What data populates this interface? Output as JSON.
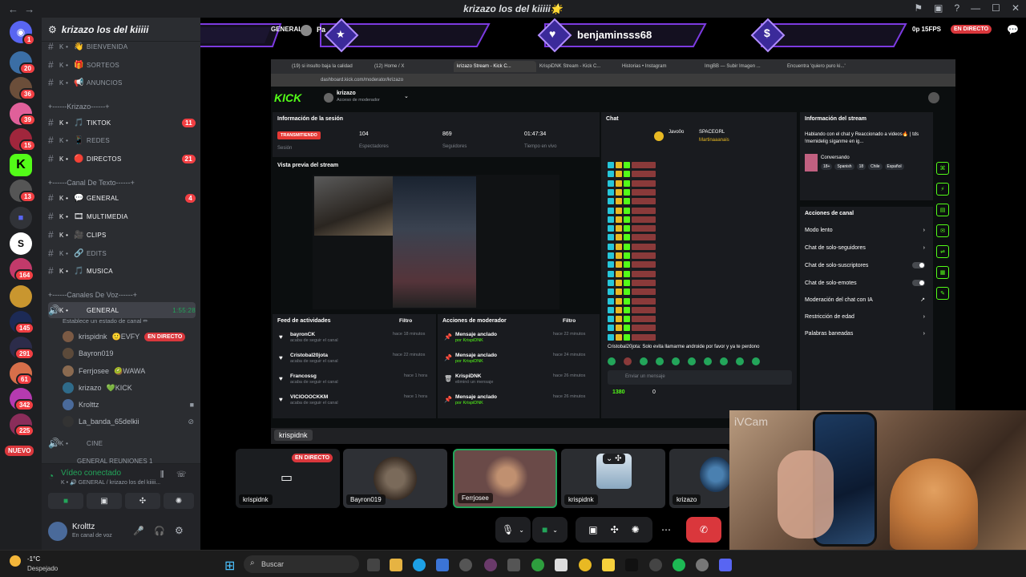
{
  "window": {
    "title": "krizazo los del kiiiii🌟",
    "back": "←",
    "forward": "→"
  },
  "rail": {
    "new_label": "NUEVO",
    "badges": [
      "1",
      "20",
      "36",
      "39",
      "15",
      "13",
      "164",
      "145",
      "291",
      "61",
      "342",
      "225"
    ]
  },
  "server": {
    "name": "krizazo los del kiiiii"
  },
  "channels": {
    "top": [
      {
        "k": "K •",
        "icon": "👋",
        "name": "BIENVENIDA",
        "count": ""
      },
      {
        "k": "K •",
        "icon": "🎁",
        "name": "SORTEOS",
        "count": ""
      },
      {
        "k": "K •",
        "icon": "📢",
        "name": "ANUNCIOS",
        "count": ""
      }
    ],
    "cat_krizazo": "+------Krizazo------+",
    "krizazo": [
      {
        "k": "K •",
        "icon": "🎵",
        "name": "TIKTOK",
        "count": "11"
      },
      {
        "k": "K •",
        "icon": "📱",
        "name": "REDES",
        "count": ""
      },
      {
        "k": "K •",
        "icon": "🔴",
        "name": "DIRECTOS",
        "count": "21"
      }
    ],
    "cat_texto": "+------Canal De Texto------+",
    "texto": [
      {
        "k": "K •",
        "icon": "💬",
        "name": "GENERAL",
        "count": "4"
      },
      {
        "k": "K •",
        "icon": "🎞",
        "name": "MULTIMEDIA",
        "count": ""
      },
      {
        "k": "K •",
        "icon": "🎥",
        "name": "CLIPS",
        "count": ""
      },
      {
        "k": "K •",
        "icon": "🔗",
        "name": "EDITS",
        "count": ""
      },
      {
        "k": "K •",
        "icon": "🎵",
        "name": "MUSICA",
        "count": ""
      }
    ],
    "cat_voz": "+------Canales De Voz------+",
    "voice_general": {
      "k": "K •",
      "icon": "🔊",
      "name": "GENERAL",
      "timer": "1:55:28",
      "status": "Establece un estado de canal ✏"
    },
    "voice_users": [
      {
        "name": "krispidnk",
        "tag": "🙂EVFY",
        "live": "EN DIRECTO",
        "color": "#7b5a44"
      },
      {
        "name": "Bayron019",
        "tag": "",
        "live": "",
        "color": "#5c4a3a"
      },
      {
        "name": "Ferrjosee",
        "tag": "🥝WAWA",
        "live": "",
        "color": "#8a6a50"
      },
      {
        "name": "krizazo",
        "tag": "💚KICK",
        "live": "",
        "color": "#2f6b8a"
      },
      {
        "name": "Krolttz",
        "tag": "",
        "live": "",
        "color": "#4a6a9a"
      },
      {
        "name": "La_banda_65delkii",
        "tag": "",
        "live": "",
        "color": "#333"
      }
    ],
    "cine": {
      "k": "K •",
      "icon": "🔊",
      "name": "CINE"
    },
    "reuniones": "GENERAL REUNIONES 1"
  },
  "voice_panel": {
    "status": "Vídeo conectado",
    "location": "K • 🔊 GENERAL / krizazo los del kiiiii..."
  },
  "user_panel": {
    "name": "Krolttz",
    "status": "En canal de voz"
  },
  "banner": {
    "ch_label": "GENERAL",
    "name1": "Pa",
    "center_name": "benjaminsss68",
    "right_text": "0p 15FPS",
    "live": "EN DIRECTO"
  },
  "browser": {
    "tabs": [
      "(19) si insulto baja la calidad",
      "(12) Home / X",
      "krizazo Stream - Kick C...",
      "KrispiDNK Stream - Kick C...",
      "Historias • Instagram",
      "ImgBB — Subir Imagen ...",
      "Encuentra 'quiero puro ki...'"
    ],
    "url": "dashboard.kick.com/moderator/krizazo"
  },
  "kick": {
    "logo": "KICK",
    "channel": "krizazo",
    "role": "Acceso de moderador",
    "session_title": "Información de la sesión",
    "live_badge": "TRANSMITIENDO",
    "session_label": "Sesión",
    "viewers": "104",
    "viewers_label": "Espectadores",
    "followers": "869",
    "followers_label": "Seguidores",
    "uptime": "01:47:34",
    "uptime_label": "Tiempo en vivo",
    "preview_title": "Vista previa del stream",
    "chat_title": "Chat",
    "chat_top1": "Javo0o",
    "chat_top2": "SPACEGRL",
    "chat_top3": "Martinaaanais",
    "chat_msg": "Cristobal20jota: Solo evita llamarme androide por favor y ya te perdono",
    "chat_placeholder": "Enviar un mensaje",
    "chat_count": "1380",
    "chat_zero": "0",
    "stream_info_title": "Información del stream",
    "stream_desc": "Hablando con el chat y Reaccionado a videos🔥 | tds !memidelig síganme en ig...",
    "category": "Conversando",
    "tags": [
      "18+",
      "Spanish",
      "18",
      "Chile",
      "Español"
    ],
    "actions_title": "Acciones de canal",
    "actions": [
      "Modo lento",
      "Chat de solo-seguidores",
      "Chat de solo-suscriptores",
      "Chat de solo-emotes",
      "Moderación del chat con IA",
      "Restricción de edad",
      "Palabras baneadas"
    ],
    "feed_title": "Feed de actividades",
    "filter": "Filtro",
    "feed": [
      {
        "name": "bayronCK",
        "sub": "acaba de seguir el canal",
        "time": "hace 18 minutos"
      },
      {
        "name": "Cristobal20jota",
        "sub": "acaba de seguir el canal",
        "time": "hace 22 minutos"
      },
      {
        "name": "Francossg",
        "sub": "acaba de seguir el canal",
        "time": "hace 1 hora"
      },
      {
        "name": "VICIOOOCKKM",
        "sub": "acaba de seguir el canal",
        "time": "hace 1 hora"
      }
    ],
    "mod_title": "Acciones de moderador",
    "mod": [
      {
        "name": "Mensaje anclado",
        "sub": "por KrispiDNK",
        "time": "hace 22 minutos"
      },
      {
        "name": "Mensaje anclado",
        "sub": "por KrispiDNK",
        "time": "hace 24 minutos"
      },
      {
        "name": "KrispiDNK",
        "sub": "eliminó un mensaje",
        "time": "hace 26 minutos"
      },
      {
        "name": "Mensaje anclado",
        "sub": "por KrispiDNK",
        "time": "hace 26 minutos"
      }
    ]
  },
  "share_label": "krispidnk",
  "tiles": [
    {
      "name": "krispidnk",
      "live": "EN DIRECTO"
    },
    {
      "name": "Bayron019"
    },
    {
      "name": "Ferrjosee"
    },
    {
      "name": "krispidnk"
    },
    {
      "name": "krizazo"
    }
  ],
  "webcam_label": "iVCam",
  "taskbar": {
    "temp": "-1°C",
    "weather": "Despejado",
    "search": "Buscar"
  }
}
